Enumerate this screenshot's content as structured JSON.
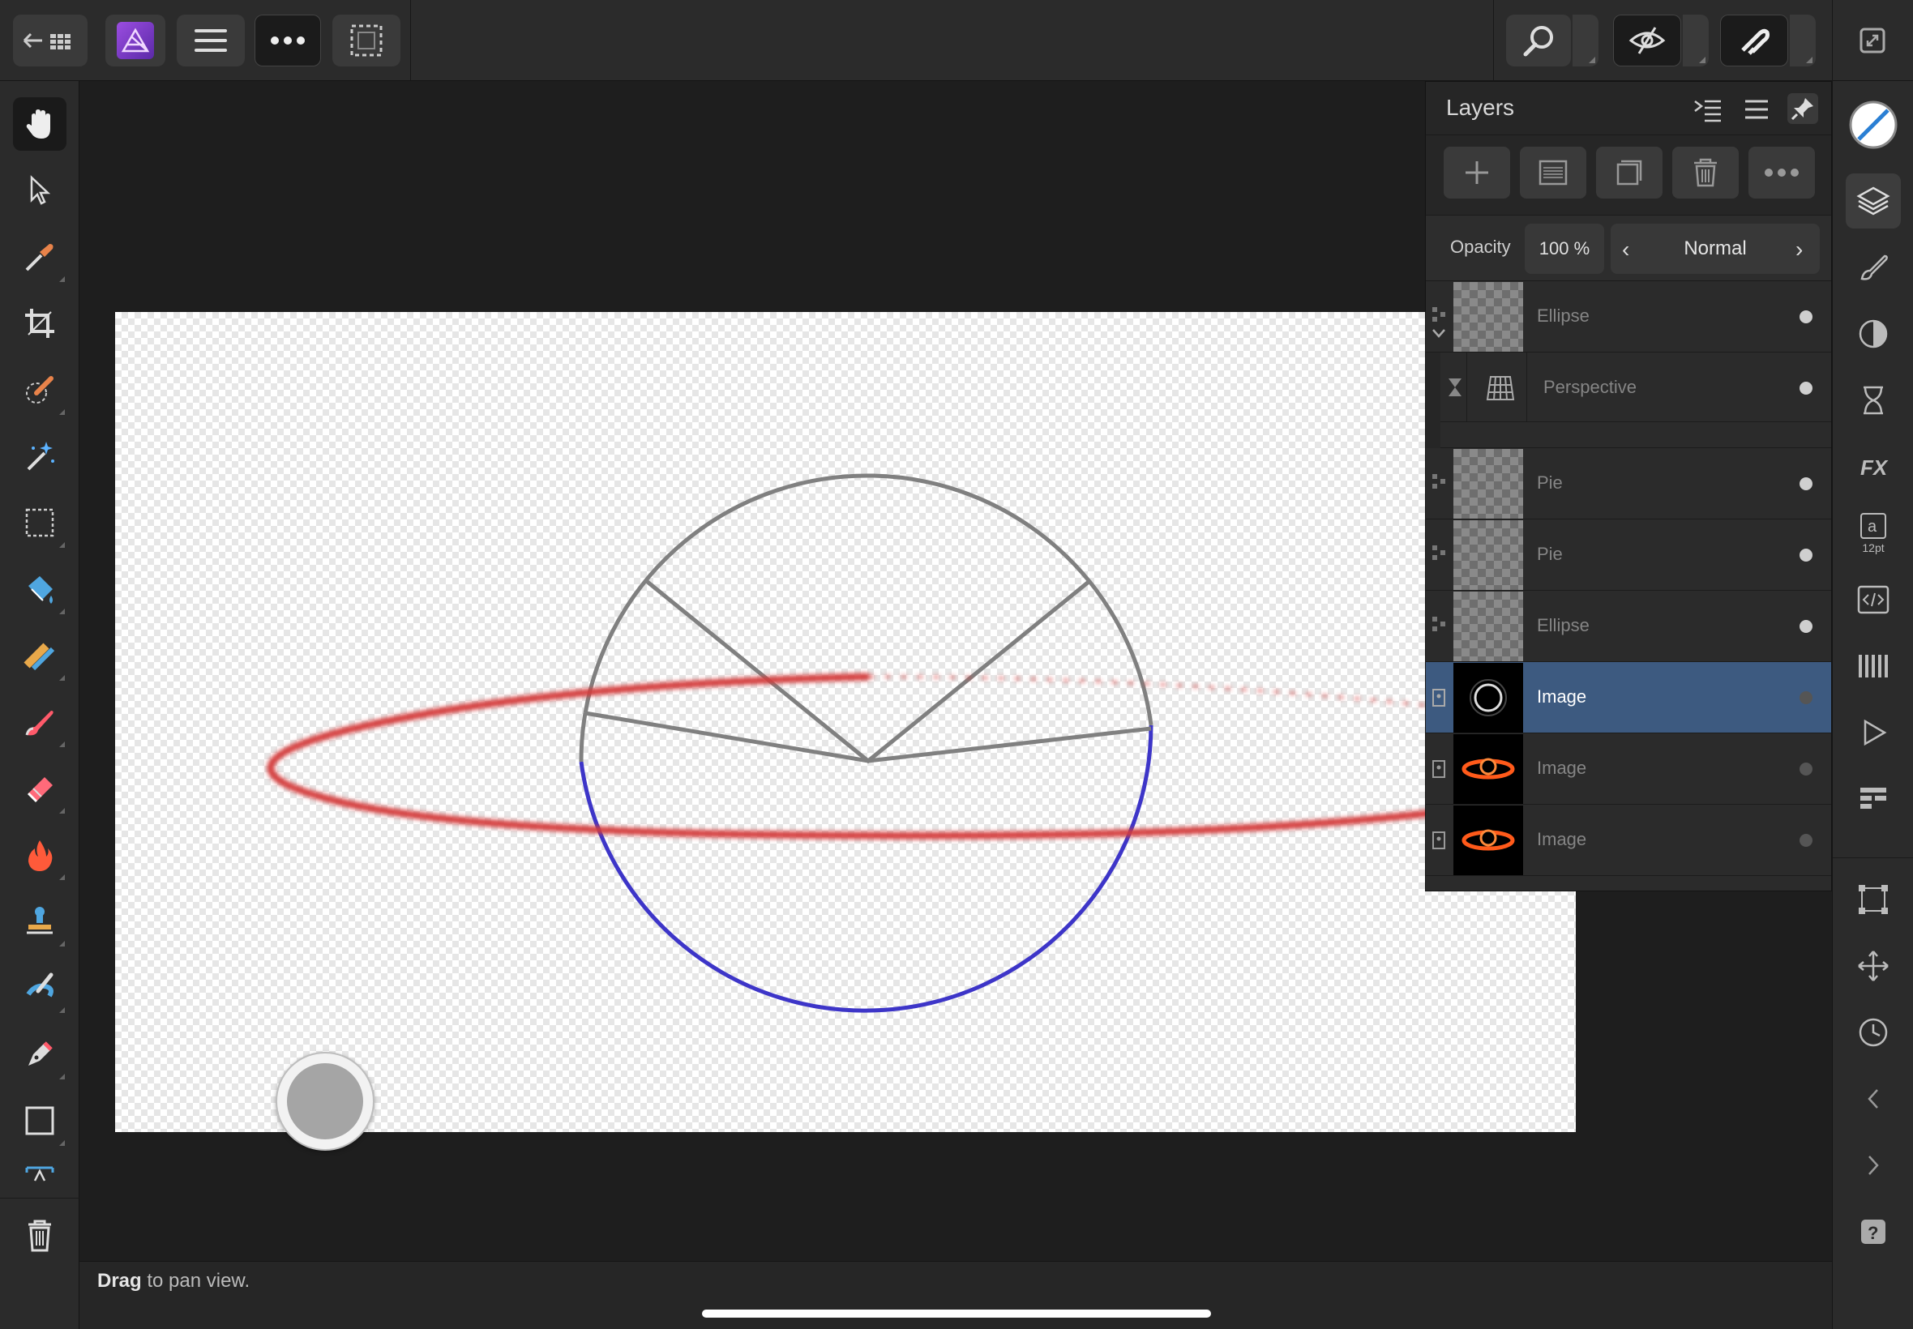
{
  "layers_panel": {
    "title": "Layers",
    "opacity_label": "Opacity",
    "opacity_value": "100 %",
    "blend_mode": "Normal",
    "rows": [
      {
        "name": "Ellipse",
        "kind": "shape"
      },
      {
        "name": "Perspective",
        "kind": "filter"
      },
      {
        "name": "Pie",
        "kind": "shape"
      },
      {
        "name": "Pie",
        "kind": "shape"
      },
      {
        "name": "Ellipse",
        "kind": "shape"
      },
      {
        "name": "Image",
        "kind": "image",
        "selected": true
      },
      {
        "name": "Image",
        "kind": "image"
      },
      {
        "name": "Image",
        "kind": "image"
      }
    ]
  },
  "status": {
    "bold": "Drag",
    "rest": " to pan view."
  },
  "studio": {
    "text_size": "12pt"
  },
  "colors": {
    "selection": "#3d5a80",
    "accent": "#7a2fd0",
    "circle_lower": "#3d35c8",
    "ring": "#d23a3a"
  }
}
